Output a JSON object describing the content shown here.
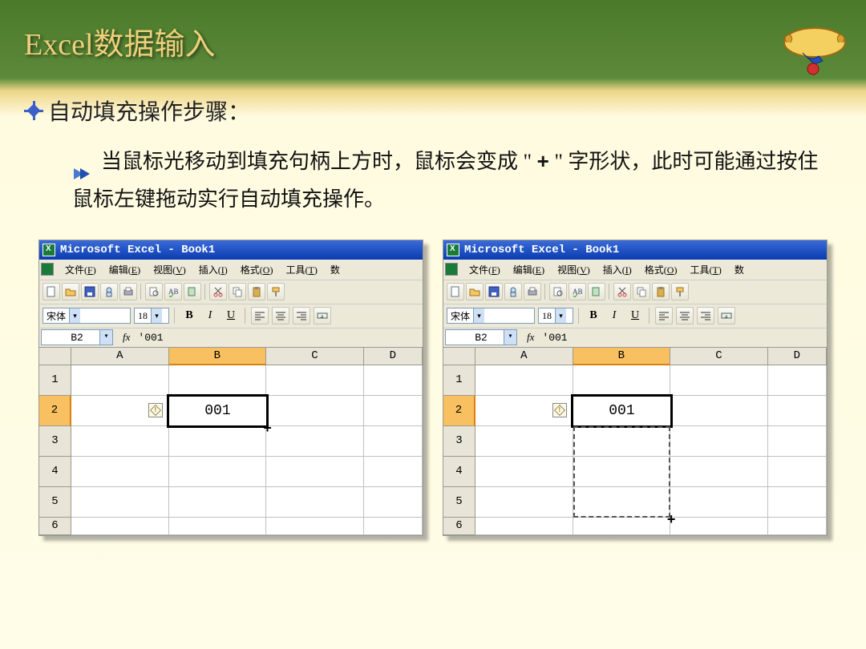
{
  "slide": {
    "title": "Excel数据输入",
    "subheading": "自动填充操作步骤：",
    "body_part1": "当鼠标光移动到填充句柄上方时，鼠标会变成 \" ",
    "body_plus": "+",
    "body_part2": " \" 字形状，此时可能通过按住鼠标左键拖动实行自动填充操作。"
  },
  "excel": {
    "window_title": "Microsoft Excel - Book1",
    "menus": [
      {
        "label": "文件",
        "key": "F"
      },
      {
        "label": "编辑",
        "key": "E"
      },
      {
        "label": "视图",
        "key": "V"
      },
      {
        "label": "插入",
        "key": "I"
      },
      {
        "label": "格式",
        "key": "O"
      },
      {
        "label": "工具",
        "key": "T"
      }
    ],
    "menu_extra": "数",
    "font_name": "宋体",
    "font_size": "18",
    "name_box": "B2",
    "formula_bar": "'001",
    "fx_label": "fx",
    "columns": [
      "A",
      "B",
      "C",
      "D"
    ],
    "rows": [
      "1",
      "2",
      "3",
      "4",
      "5",
      "6"
    ],
    "cell_value": "001",
    "active_col": "B",
    "active_row": "2",
    "fill_cursor": "+"
  }
}
